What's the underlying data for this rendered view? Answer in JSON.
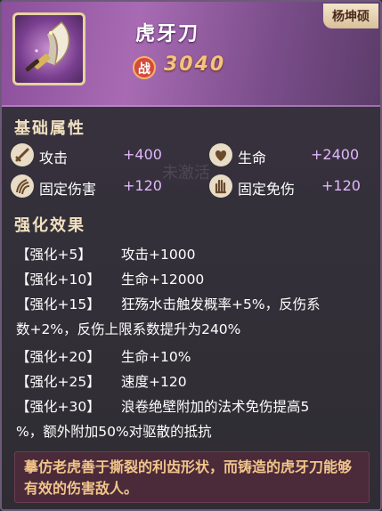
{
  "item": {
    "name": "虎牙刀",
    "owner": "杨坤硕",
    "power_label": "战",
    "power_value": "3040"
  },
  "base": {
    "title": "基础属性",
    "attributes": [
      {
        "icon": "sword-icon",
        "label": "攻击",
        "value": "+400"
      },
      {
        "icon": "heart-icon",
        "label": "生命",
        "value": "+2400"
      },
      {
        "icon": "claw-icon",
        "label": "固定伤害",
        "value": "+120"
      },
      {
        "icon": "hand-icon",
        "label": "固定免伤",
        "value": "+120"
      }
    ]
  },
  "enhance": {
    "title": "强化效果",
    "effects": [
      {
        "tag": "【强化+5】",
        "text": "攻击+1000"
      },
      {
        "tag": "【强化+10】",
        "text": "生命+12000"
      },
      {
        "tag": "【强化+15】",
        "text": "狂殇水击触发概率+5%，反伤系",
        "cont": "数+2%，反伤上限系数提升为240%"
      },
      {
        "tag": "【强化+20】",
        "text": "生命+10%"
      },
      {
        "tag": "【强化+25】",
        "text": "速度+120"
      },
      {
        "tag": "【强化+30】",
        "text": "浪卷绝壁附加的法术免伤提高5",
        "cont": "%，额外附加50%对驱散的抵抗"
      }
    ]
  },
  "description": "摹仿老虎善于撕裂的利齿形状，而铸造的虎牙刀能够有效的伤害敌人。",
  "background": {
    "ghost_label": "未激活"
  }
}
